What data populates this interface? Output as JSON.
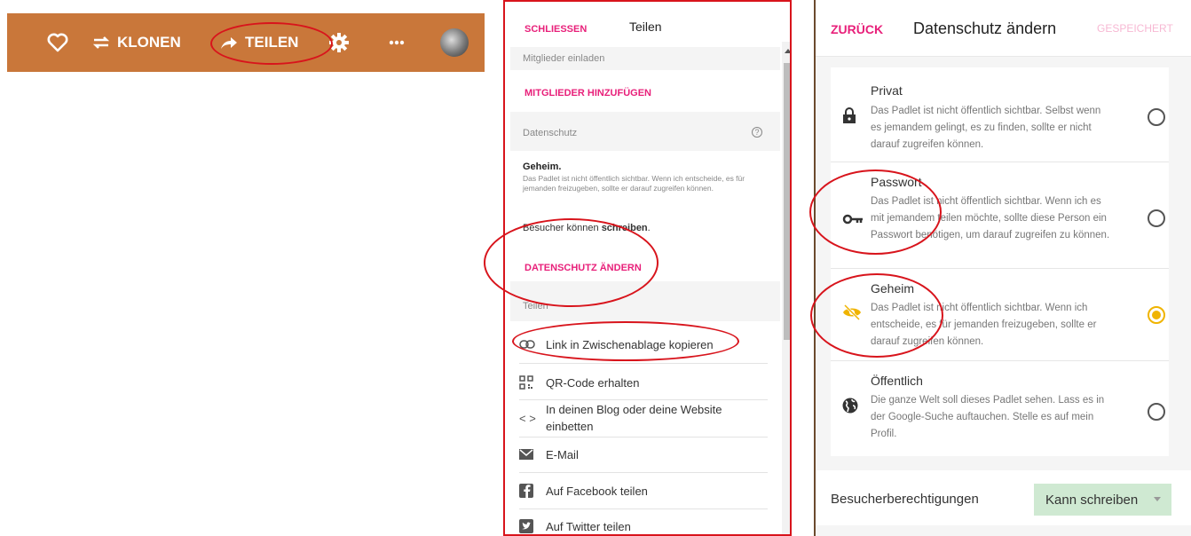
{
  "toolbar": {
    "clone_label": "KLONEN",
    "share_label": "TEILEN",
    "bg_color": "#c9773a"
  },
  "share_panel": {
    "close_label": "SCHLIESSEN",
    "title": "Teilen",
    "members_section": "Mitglieder einladen",
    "add_members_label": "MITGLIEDER HINZUFÜGEN",
    "privacy_section": "Datenschutz",
    "privacy_name": "Geheim",
    "privacy_desc": "Das Padlet ist nicht öffentlich sichtbar. Wenn ich entscheide, es für jemanden freizugeben, sollte er darauf zugreifen können.",
    "visitors_prefix": "Besucher können",
    "visitors_perm": "schreiben",
    "change_privacy_label": "DATENSCHUTZ ÄNDERN",
    "share_section": "Teilen",
    "items": [
      {
        "icon": "link-icon",
        "label": "Link in Zwischenablage kopieren"
      },
      {
        "icon": "qr-code-icon",
        "label": "QR-Code erhalten"
      },
      {
        "icon": "code-icon",
        "label": "In deinen Blog oder deine Website einbetten"
      },
      {
        "icon": "mail-icon",
        "label": "E-Mail"
      },
      {
        "icon": "facebook-icon",
        "label": "Auf Facebook teilen"
      },
      {
        "icon": "twitter-icon",
        "label": "Auf Twitter teilen"
      }
    ],
    "accent_color": "#e8207a"
  },
  "privacy_panel": {
    "back_label": "ZURÜCK",
    "title": "Datenschutz ändern",
    "saved_label": "GESPEICHERT",
    "options": [
      {
        "icon": "lock-icon",
        "title": "Privat",
        "desc": "Das Padlet ist nicht öffentlich sichtbar. Selbst wenn es jemandem gelingt, es zu finden, sollte er nicht darauf zugreifen können.",
        "selected": false
      },
      {
        "icon": "key-icon",
        "title": "Passwort",
        "desc": "Das Padlet ist nicht öffentlich sichtbar. Wenn ich es mit jemandem teilen möchte, sollte diese Person ein Passwort benötigen, um darauf zugreifen zu können.",
        "selected": false
      },
      {
        "icon": "eye-off-icon",
        "title": "Geheim",
        "desc": "Das Padlet ist nicht öffentlich sichtbar. Wenn ich entscheide, es für jemanden freizugeben, sollte er darauf zugreifen können.",
        "selected": true
      },
      {
        "icon": "globe-icon",
        "title": "Öffentlich",
        "desc": "Die ganze Welt soll dieses Padlet sehen. Lass es in der Google-Suche auftauchen. Stelle es auf mein Profil.",
        "selected": false
      }
    ],
    "permissions_label": "Besucherberechtigungen",
    "permissions_value": "Kann schreiben",
    "selected_color": "#f0b400",
    "permissions_bg": "#cfe9d2"
  }
}
